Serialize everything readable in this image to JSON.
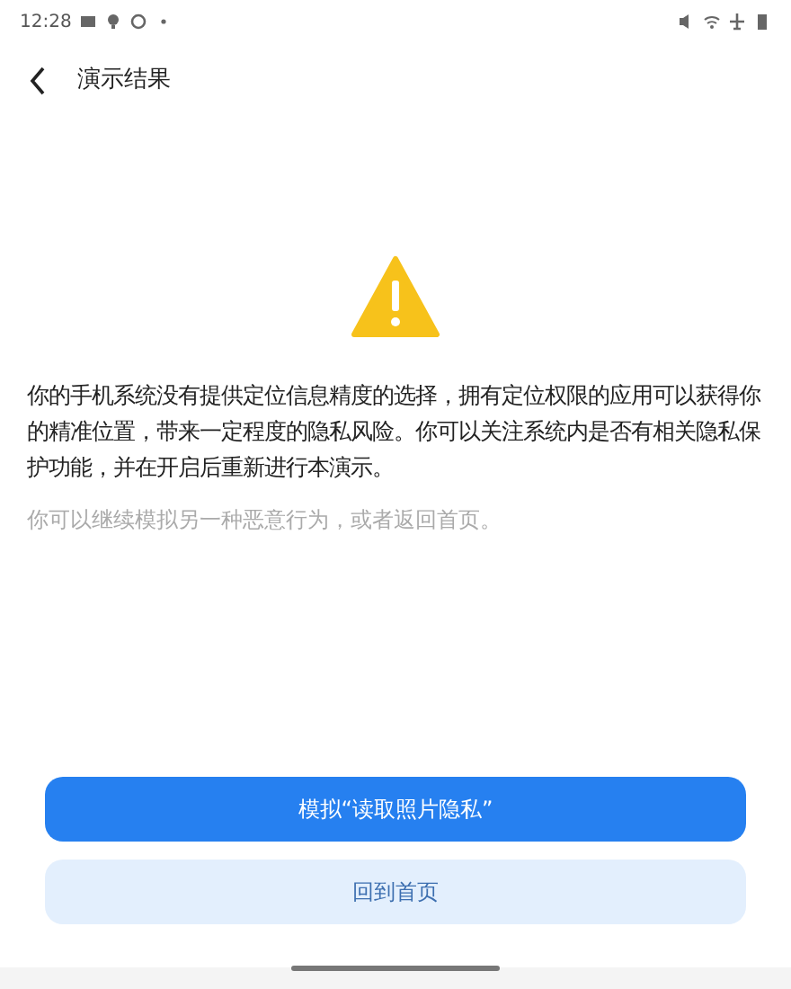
{
  "status_bar": {
    "time": "12:28"
  },
  "header": {
    "title": "演示结果"
  },
  "message": "你的手机系统没有提供定位信息精度的选择，拥有定位权限的应用可以获得你的精准位置，带来一定程度的隐私风险。你可以关注系统内是否有相关隐私保护功能，并在开启后重新进行本演示。",
  "hint": "你可以继续模拟另一种恶意行为，或者返回首页。",
  "buttons": [
    {
      "label": "模拟“读取照片隐私”",
      "kind": "primary"
    },
    {
      "label": "回到首页",
      "kind": "secondary"
    }
  ]
}
